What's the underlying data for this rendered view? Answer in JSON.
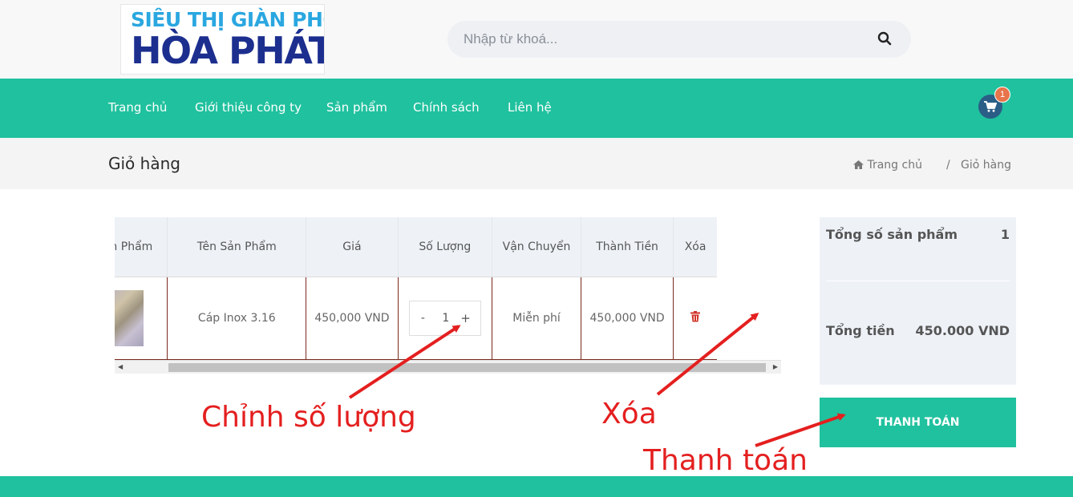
{
  "header": {
    "logo_line1": "SIÊU THỊ GIÀN PHƠI",
    "logo_line2": "HÒA PHÁT",
    "search_placeholder": "Nhập từ khoá...",
    "search_icon": "search-icon"
  },
  "nav": {
    "items": [
      "Trang chủ",
      "Giới thiệu công ty",
      "Sản phẩm",
      "Chính sách",
      "Liên hệ"
    ],
    "cart_icon": "shopping-cart-icon",
    "cart_count": "1"
  },
  "page": {
    "title": "Giỏ hàng",
    "breadcrumb": {
      "home": "Trang chủ",
      "separator": "/",
      "current": "Giỏ hàng"
    }
  },
  "cart_table": {
    "headers": [
      "Ảnh Sản Phẩm",
      "Tên Sản Phẩm",
      "Giá",
      "Số Lượng",
      "Vận Chuyển",
      "Thành Tiền",
      "Xóa"
    ],
    "rows": [
      {
        "name": "Cáp Inox 3.16",
        "price": "450,000 VND",
        "qty_minus": "-",
        "quantity": "1",
        "qty_plus": "+",
        "shipping": "Miễn phí",
        "subtotal": "450,000 VND"
      }
    ]
  },
  "summary": {
    "total_items_label": "Tổng số sản phẩm",
    "total_items_value": "1",
    "total_price_label": "Tổng tiền",
    "total_price_value": "450.000 VND",
    "checkout_label": "THANH TOÁN"
  },
  "annotations": {
    "qty": "Chỉnh số lượng",
    "delete": "Xóa",
    "checkout": "Thanh toán",
    "color": "#e41f1f"
  },
  "colors": {
    "accent": "#20c19e",
    "cart_bg": "#2a5e86",
    "badge": "#e8744b"
  }
}
